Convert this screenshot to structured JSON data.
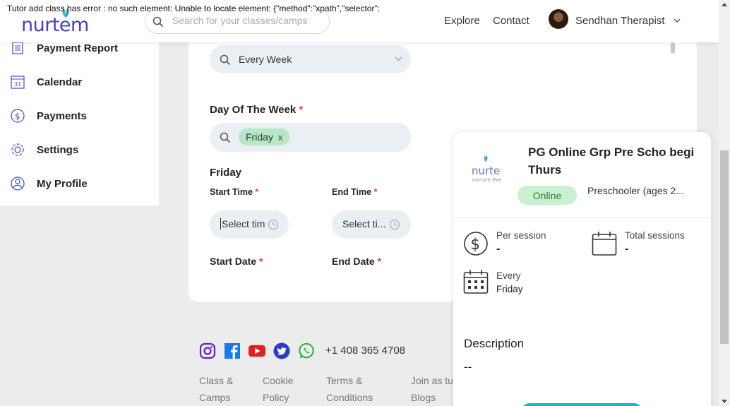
{
  "error_banner": "Tutor add class has error : no such element: Unable to locate element: {\"method\":\"xpath\",\"selector\":",
  "header": {
    "logo_text": "nurtem",
    "search_placeholder": "Search for your classes/camps",
    "nav": [
      "Explore",
      "Contact"
    ],
    "user_name": "Sendhan Therapist"
  },
  "sidebar": {
    "items": [
      {
        "label": "Payment Report",
        "icon": "report-icon"
      },
      {
        "label": "Calendar",
        "icon": "calendar-icon"
      },
      {
        "label": "Payments",
        "icon": "dollar-icon"
      },
      {
        "label": "Settings",
        "icon": "gear-icon"
      },
      {
        "label": "My Profile",
        "icon": "user-icon"
      }
    ]
  },
  "form": {
    "frequency_value": "Every Week",
    "day_of_week_label": "Day Of The Week",
    "required_mark": "*",
    "selected_day_tag": "Friday",
    "tag_remove": "x",
    "day_heading": "Friday",
    "start_time_label": "Start Time",
    "end_time_label": "End Time",
    "start_time_placeholder": "Select time",
    "end_time_placeholder": "Select ti...",
    "start_date_label": "Start Date",
    "end_date_label": "End Date"
  },
  "footer": {
    "phone": "+1 408 365 4708",
    "socials": [
      "instagram-icon",
      "facebook-icon",
      "youtube-icon",
      "twitter-icon",
      "whatsapp-icon"
    ],
    "links": [
      {
        "line1": "Class &",
        "line2": "Camps"
      },
      {
        "line1": "Cookie",
        "line2": "Policy"
      },
      {
        "line1": "Terms &",
        "line2": "Conditions"
      },
      {
        "line1": "Join as tutor",
        "line2": "Blogs"
      }
    ]
  },
  "preview": {
    "logo_line1": "nurtem",
    "logo_line2": "nurture them",
    "title": "PG Online Grp Pre Scho begi Thurs",
    "mode_badge": "Online",
    "age_group": "Preschooler (ages 2...",
    "per_session_label": "Per session",
    "per_session_value": "-",
    "total_sessions_label": "Total sessions",
    "total_sessions_value": "-",
    "frequency_label": "Every",
    "frequency_day": "Friday",
    "description_label": "Description",
    "description_value": "--"
  },
  "colors": {
    "brand": "#4a3fc4",
    "accent_teal": "#19b4c9",
    "required": "#e0424c",
    "tag_green": "#b6e7c6"
  }
}
